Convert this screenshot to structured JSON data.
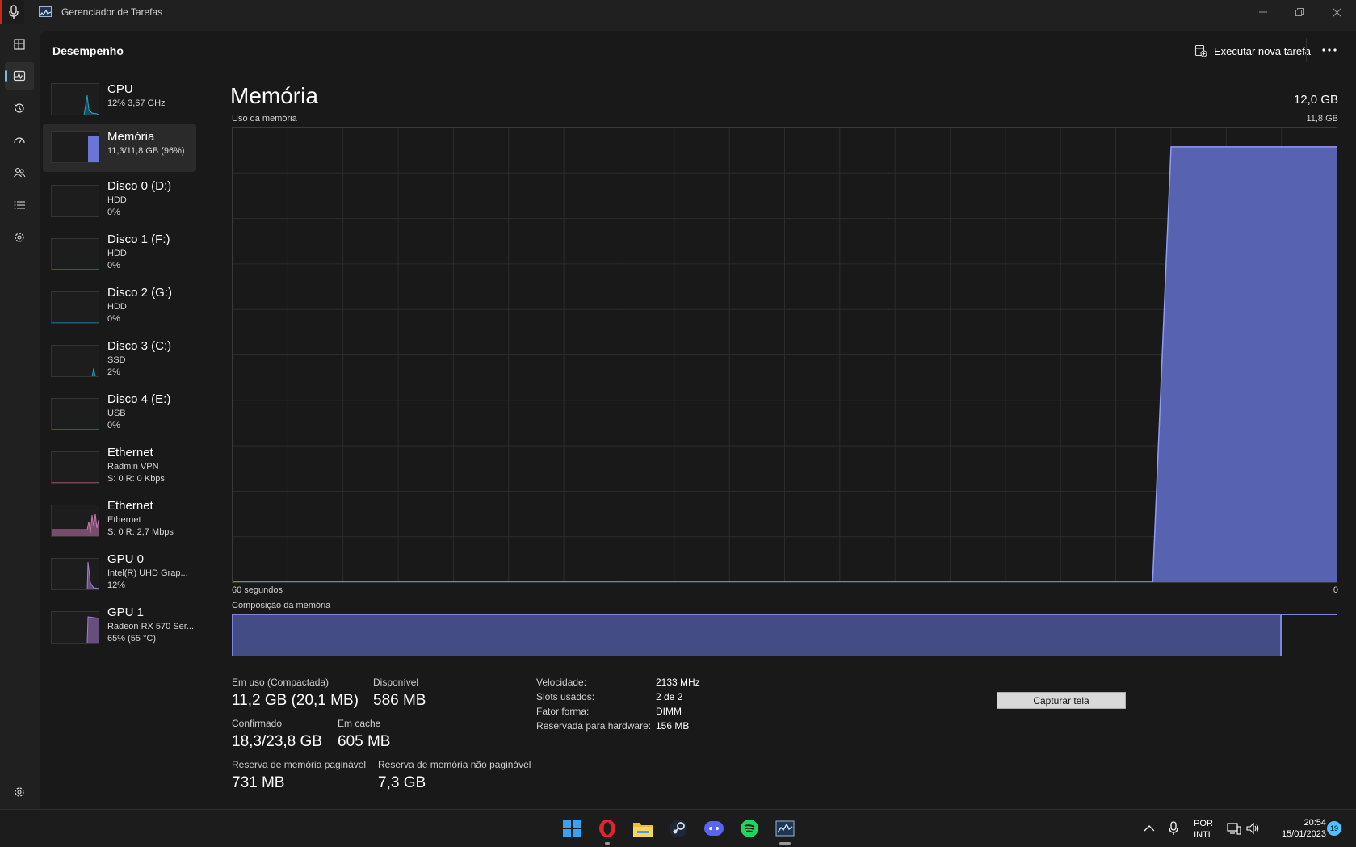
{
  "window": {
    "title": "Gerenciador de Tarefas"
  },
  "header": {
    "title": "Desempenho",
    "run_task": "Executar nova tarefa"
  },
  "sidebar": {
    "items": [
      {
        "title": "CPU",
        "line1": "12% 3,67 GHz",
        "line2": ""
      },
      {
        "title": "Memória",
        "line1": "11,3/11,8 GB (96%)",
        "line2": ""
      },
      {
        "title": "Disco 0 (D:)",
        "line1": "HDD",
        "line2": "0%"
      },
      {
        "title": "Disco 1 (F:)",
        "line1": "HDD",
        "line2": "0%"
      },
      {
        "title": "Disco 2 (G:)",
        "line1": "HDD",
        "line2": "0%"
      },
      {
        "title": "Disco 3 (C:)",
        "line1": "SSD",
        "line2": "2%"
      },
      {
        "title": "Disco 4 (E:)",
        "line1": "USB",
        "line2": "0%"
      },
      {
        "title": "Ethernet",
        "line1": "Radmin VPN",
        "line2": "S: 0 R: 0 Kbps"
      },
      {
        "title": "Ethernet",
        "line1": "Ethernet",
        "line2": "S: 0 R: 2,7 Mbps"
      },
      {
        "title": "GPU 0",
        "line1": "Intel(R) UHD Grap...",
        "line2": "12%"
      },
      {
        "title": "GPU 1",
        "line1": "Radeon RX 570 Ser...",
        "line2": "65% (55 °C)"
      }
    ]
  },
  "memory": {
    "title": "Memória",
    "total": "12,0 GB",
    "usage_label": "Uso da memória",
    "graph_max": "11,8 GB",
    "time_span": "60 segundos",
    "time_end": "0",
    "composition_label": "Composição da memória",
    "in_use_fraction": 0.95,
    "stats": {
      "in_use_label": "Em uso (Compactada)",
      "in_use": "11,2 GB (20,1 MB)",
      "available_label": "Disponível",
      "available": "586 MB",
      "committed_label": "Confirmado",
      "committed": "18,3/23,8 GB",
      "cached_label": "Em cache",
      "cached": "605 MB",
      "paged_label": "Reserva de memória paginável",
      "paged": "731 MB",
      "nonpaged_label": "Reserva de memória não paginável",
      "nonpaged": "7,3 GB"
    },
    "specs": {
      "speed_label": "Velocidade:",
      "speed": "2133 MHz",
      "slots_label": "Slots usados:",
      "slots": "2 de 2",
      "form_label": "Fator forma:",
      "form": "DIMM",
      "reserved_label": "Reservada para hardware:",
      "reserved": "156 MB"
    },
    "capture_button": "Capturar tela"
  },
  "chart_data": {
    "type": "area",
    "title": "Uso da memória",
    "xlabel": "60 segundos",
    "ylabel": "",
    "xlim": [
      60,
      0
    ],
    "ylim": [
      0,
      11.8
    ],
    "x": [
      60,
      58,
      56,
      54,
      52,
      50,
      48,
      46,
      44,
      42,
      40,
      38,
      36,
      34,
      32,
      30,
      28,
      26,
      24,
      22,
      20,
      18,
      16,
      14,
      12,
      10,
      9,
      8,
      7,
      6,
      5,
      4,
      3,
      2,
      1,
      0
    ],
    "values": [
      0,
      0,
      0,
      0,
      0,
      0,
      0,
      0,
      0,
      0,
      0,
      0,
      0,
      0,
      0,
      0,
      0,
      0,
      0,
      0,
      0,
      0,
      0,
      0,
      0,
      0,
      11.3,
      11.3,
      11.3,
      11.3,
      11.3,
      11.3,
      11.3,
      11.3,
      11.3,
      11.3
    ],
    "grid": true,
    "colors": {
      "fill": "#5b66b8",
      "line": "#8f9cf2"
    }
  },
  "taskbar": {
    "language_line1": "POR",
    "language_line2": "INTL",
    "time": "20:54",
    "date": "15/01/2023",
    "notifications": "19"
  },
  "icons": {
    "nav": [
      "processes-icon",
      "performance-icon",
      "app-history-icon",
      "startup-apps-icon",
      "users-icon",
      "details-icon",
      "services-icon",
      "settings-icon"
    ]
  }
}
